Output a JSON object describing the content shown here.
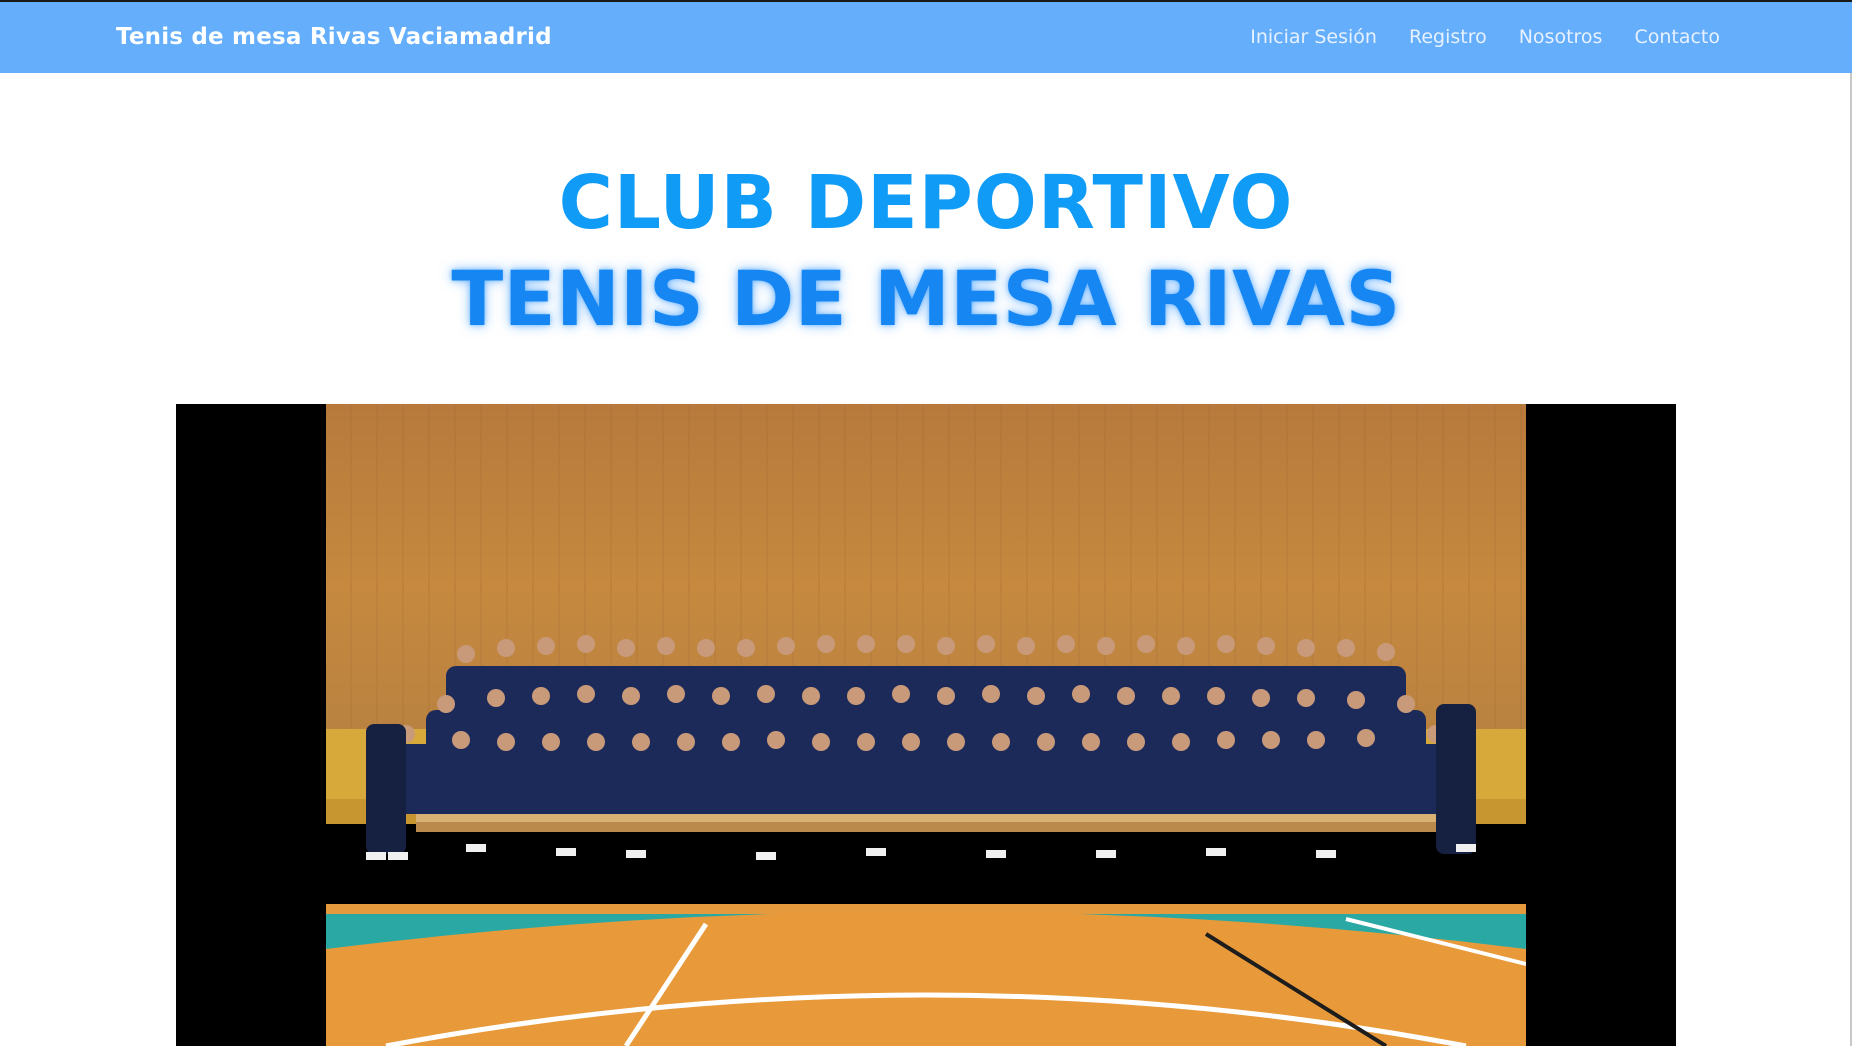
{
  "navbar": {
    "brand": "Tenis de mesa Rivas Vaciamadrid",
    "links": [
      "Iniciar Sesión",
      "Registro",
      "Nosotros",
      "Contacto"
    ]
  },
  "hero": {
    "line1": "CLUB DEPORTIVO",
    "line2": "TENIS DE MESA RIVAS"
  },
  "colors": {
    "navbar": "#64aefc",
    "heading1": "#0f9bf6",
    "heading2": "#1586f2",
    "video_bg": "#000000"
  },
  "media": {
    "icon": "team-photo"
  }
}
